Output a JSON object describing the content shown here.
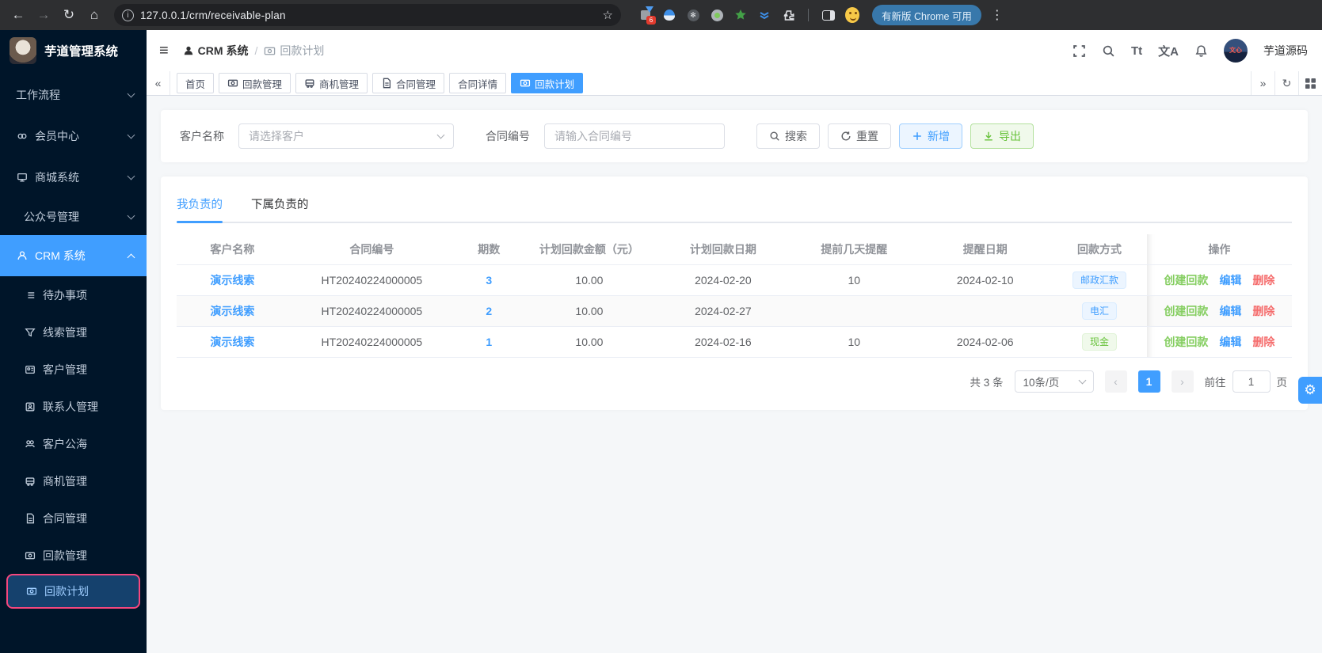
{
  "browser": {
    "url": "127.0.0.1/crm/receivable-plan",
    "update_chip": "有新版 Chrome 可用",
    "extension_badge": "6"
  },
  "icons": {
    "back": "←",
    "forward": "→",
    "reload": "↻",
    "home": "⌂",
    "star": "☆",
    "menu_dots": "⋮",
    "hamburger": "≡",
    "snow_glyph": "✻",
    "tabs_collapse_left": "«",
    "tabs_collapse_right": "»",
    "tabs_refresh": "↻",
    "gear": "⚙",
    "page_prev": "‹",
    "page_next": "›"
  },
  "header": {
    "logo_title": "芋道管理系统",
    "breadcrumb": {
      "root": "CRM 系统",
      "sep": "/",
      "current": "回款计划"
    },
    "font_size_button": "Tt",
    "translate_button": "文A",
    "avatar_text": "文心",
    "user_name": "芋道源码"
  },
  "sidebar": {
    "items": [
      {
        "label": "工作流程",
        "level": 1,
        "icon": null,
        "chevron": "down"
      },
      {
        "label": "会员中心",
        "level": 1,
        "icon": "member-icon",
        "chevron": "down"
      },
      {
        "label": "商城系统",
        "level": 1,
        "icon": "mall-icon",
        "chevron": "down"
      },
      {
        "label": "公众号管理",
        "level": 2,
        "icon": null,
        "chevron": "down"
      },
      {
        "label": "CRM 系统",
        "level": 1,
        "icon": "user-icon",
        "chevron": "up",
        "active": true
      },
      {
        "label": "待办事项",
        "level": 2,
        "icon": "todo-icon"
      },
      {
        "label": "线索管理",
        "level": 2,
        "icon": "clue-icon"
      },
      {
        "label": "客户管理",
        "level": 2,
        "icon": "customer-icon"
      },
      {
        "label": "联系人管理",
        "level": 2,
        "icon": "contact-icon"
      },
      {
        "label": "客户公海",
        "level": 2,
        "icon": "pool-icon"
      },
      {
        "label": "商机管理",
        "level": 2,
        "icon": "business-icon"
      },
      {
        "label": "合同管理",
        "level": 2,
        "icon": "contract-icon"
      },
      {
        "label": "回款管理",
        "level": 2,
        "icon": "receivable-icon"
      },
      {
        "label": "回款计划",
        "level": 2,
        "icon": "plan-icon",
        "highlighted": true
      }
    ]
  },
  "tags_view": {
    "tabs": [
      {
        "label": "首页",
        "icon": null,
        "active": false
      },
      {
        "label": "回款管理",
        "icon": "money-icon",
        "active": false
      },
      {
        "label": "商机管理",
        "icon": "business-icon",
        "active": false
      },
      {
        "label": "合同管理",
        "icon": "contract-icon",
        "active": false
      },
      {
        "label": "合同详情",
        "icon": null,
        "active": false
      },
      {
        "label": "回款计划",
        "icon": "money-icon",
        "active": true
      }
    ]
  },
  "filter": {
    "customer_label": "客户名称",
    "customer_placeholder": "请选择客户",
    "contract_label": "合同编号",
    "contract_placeholder": "请输入合同编号",
    "search_button": "搜索",
    "reset_button": "重置",
    "add_button": "新增",
    "export_button": "导出"
  },
  "panel": {
    "tab_mine": "我负责的",
    "tab_subordinate": "下属负责的"
  },
  "table": {
    "columns": [
      "客户名称",
      "合同编号",
      "期数",
      "计划回款金额（元）",
      "计划回款日期",
      "提前几天提醒",
      "提醒日期",
      "回款方式",
      "操作"
    ],
    "rows": [
      {
        "customer": "演示线索",
        "contract_no": "HT20240224000005",
        "period": "3",
        "amount": "10.00",
        "plan_date": "2024-02-20",
        "remind_days": "10",
        "remind_date": "2024-02-10",
        "method": "邮政汇款",
        "method_type": "primary",
        "actions": [
          "创建回款",
          "编辑",
          "删除"
        ]
      },
      {
        "customer": "演示线索",
        "contract_no": "HT20240224000005",
        "period": "2",
        "amount": "10.00",
        "plan_date": "2024-02-27",
        "remind_days": "",
        "remind_date": "",
        "method": "电汇",
        "method_type": "primary",
        "actions": [
          "创建回款",
          "编辑",
          "删除"
        ]
      },
      {
        "customer": "演示线索",
        "contract_no": "HT20240224000005",
        "period": "1",
        "amount": "10.00",
        "plan_date": "2024-02-16",
        "remind_days": "10",
        "remind_date": "2024-02-06",
        "method": "现金",
        "method_type": "success",
        "actions": [
          "创建回款",
          "编辑",
          "删除"
        ]
      }
    ]
  },
  "pagination": {
    "total": "共 3 条",
    "page_size": "10条/页",
    "current_page": "1",
    "goto_label": "前往",
    "goto_value": "1",
    "page_suffix": "页"
  },
  "colors": {
    "primary": "#409eff",
    "success": "#67c23a",
    "danger": "#f56c6c",
    "sidebar_bg": "#001529",
    "annotation_border": "#f5477e",
    "tag_primary_bg": "#ecf5ff",
    "tag_success_bg": "#f0f9eb"
  }
}
